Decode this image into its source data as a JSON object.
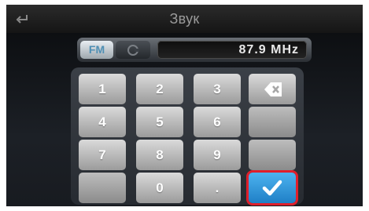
{
  "title": "Звук",
  "icons": {
    "back": "back-arrow-icon",
    "am": "am-band-icon",
    "backspace": "backspace-icon",
    "confirm": "checkmark-icon"
  },
  "tuner": {
    "band_fm": "FM",
    "frequency": "87.9  MHz"
  },
  "keypad": {
    "keys": [
      "1",
      "2",
      "3",
      "4",
      "5",
      "6",
      "7",
      "8",
      "9",
      "0",
      "."
    ]
  },
  "colors": {
    "accent": "#2b93d9",
    "highlight": "#e01f2b"
  }
}
